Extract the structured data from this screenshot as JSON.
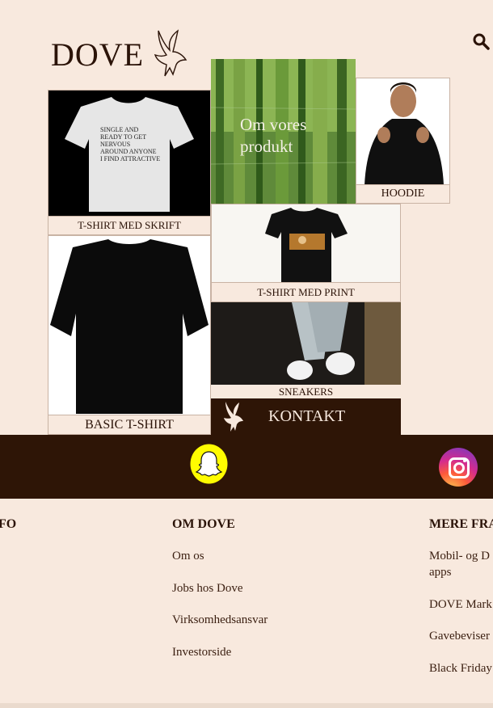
{
  "header": {
    "logo": "DOVE"
  },
  "tiles": {
    "tshirt_skrift": {
      "caption": "T-SHIRT MED SKRIFT",
      "shirt_text": "SINGLE AND\nREADY TO GET\nNERVOUS\nAROUND ANYONE\nI FIND ATTRACTIVE"
    },
    "om_produkt": {
      "label": "Om vores produkt"
    },
    "hoodie": {
      "caption": "HOODIE"
    },
    "tshirt_print": {
      "caption": "T-SHIRT MED PRINT"
    },
    "basic": {
      "caption": "BASIC T-SHIRT"
    },
    "sneakers": {
      "caption": "SNEAKERS"
    },
    "kontakt": {
      "label": "KONTAKT"
    }
  },
  "social": {
    "snapchat": "snapchat-icon",
    "instagram": "instagram-icon"
  },
  "footer": {
    "col1": {
      "heading": "FO"
    },
    "col2": {
      "heading": "OM DOVE",
      "links": [
        "Om os",
        "Jobs hos Dove",
        "Virksomhedsansvar",
        "Investorside"
      ]
    },
    "col3": {
      "heading": "MERE FRA",
      "links": [
        "Mobil- og D",
        "apps",
        "DOVE Mark",
        "Gavebeviser",
        "Black Friday"
      ]
    }
  },
  "colors": {
    "background": "#f8e9de",
    "dark": "#2e1506"
  }
}
